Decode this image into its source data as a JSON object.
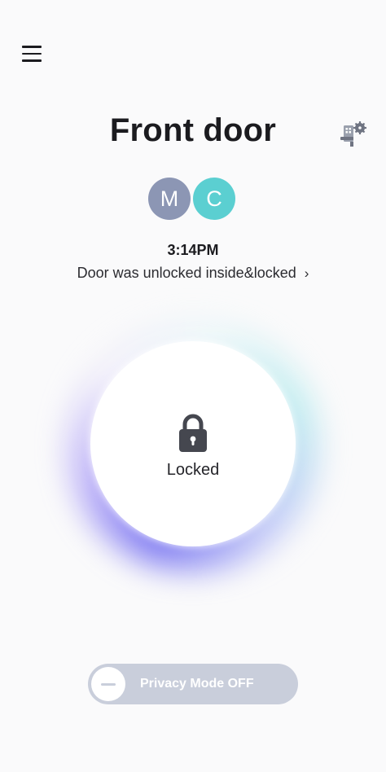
{
  "header": {
    "menu_icon": "hamburger-menu-icon",
    "settings_icon": "door-lock-settings-icon"
  },
  "device": {
    "title": "Front door"
  },
  "users": [
    {
      "initial": "M",
      "color": "#8c96b4"
    },
    {
      "initial": "C",
      "color": "#5bcfd1"
    }
  ],
  "last_event": {
    "time": "3:14PM",
    "description": "Door was unlocked inside&locked",
    "chevron": "›"
  },
  "lock": {
    "icon": "padlock-icon",
    "status": "Locked",
    "glow_colors": [
      "#6e69f0",
      "#8ce1e6"
    ]
  },
  "privacy_mode": {
    "label": "Privacy Mode OFF",
    "enabled": false
  }
}
